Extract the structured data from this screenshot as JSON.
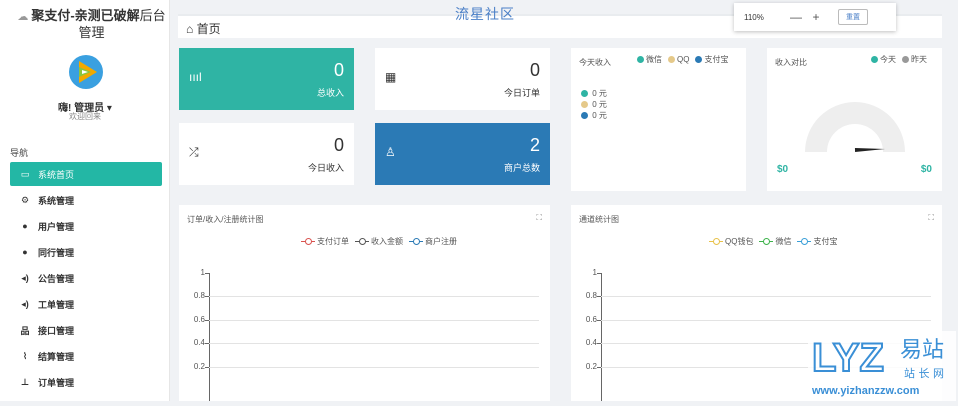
{
  "brand": {
    "cloud_icon": "cloud-icon",
    "bold": "聚支付-亲测已破解",
    "rest": "后台管理"
  },
  "user": {
    "name": "嗨! 管理员 ▾",
    "welcome": "欢迎回来"
  },
  "nav": {
    "header": "导航",
    "items": [
      {
        "label": "系统首页",
        "icon": "▭",
        "active": true
      },
      {
        "label": "系统管理",
        "icon": "⚙",
        "active": false
      },
      {
        "label": "用户管理",
        "icon": "●",
        "active": false
      },
      {
        "label": "同行管理",
        "icon": "●",
        "active": false
      },
      {
        "label": "公告管理",
        "icon": "◂)",
        "active": false
      },
      {
        "label": "工单管理",
        "icon": "◂)",
        "active": false
      },
      {
        "label": "接口管理",
        "icon": "品",
        "active": false
      },
      {
        "label": "结算管理",
        "icon": "⌇",
        "active": false
      },
      {
        "label": "订单管理",
        "icon": "⊥",
        "active": false
      }
    ]
  },
  "topbar": {
    "home_icon": "⌂",
    "title": "首页"
  },
  "watermark_top": "流星社区",
  "zoom": {
    "value": "110%",
    "minus": "—",
    "plus": "+",
    "reset": "重置"
  },
  "tiles": [
    {
      "icon": "ıııl",
      "value": "0",
      "label": "总收入"
    },
    {
      "icon": "▦",
      "value": "0",
      "label": "今日订单"
    },
    {
      "icon": "⤮",
      "value": "0",
      "label": "今日收入"
    },
    {
      "icon": "♙",
      "value": "2",
      "label": "商户总数"
    }
  ],
  "today_income": {
    "title": "今天收入",
    "legend": [
      "微信",
      "QQ",
      "支付宝"
    ],
    "items": [
      "0 元",
      "0 元",
      "0 元"
    ],
    "colors": [
      "#2fb4a4",
      "#e5c98a",
      "#2b7ab5"
    ]
  },
  "compare": {
    "title": "收入对比",
    "legend": [
      "今天",
      "昨天"
    ],
    "left": "$0",
    "right": "$0"
  },
  "chart1": {
    "title": "订单/收入/注册统计图",
    "expand": "⛶",
    "legend": [
      "支付订单",
      "收入金额",
      "商户注册"
    ]
  },
  "chart2": {
    "title": "通道统计图",
    "expand": "⛶",
    "legend": [
      "QQ钱包",
      "微信",
      "支付宝"
    ]
  },
  "chart_data": [
    {
      "type": "line",
      "title": "订单/收入/注册统计图",
      "series": [
        {
          "name": "支付订单",
          "values": []
        },
        {
          "name": "收入金额",
          "values": []
        },
        {
          "name": "商户注册",
          "values": []
        }
      ],
      "yticks": [
        "1",
        "0.8",
        "0.6",
        "0.4",
        "0.2"
      ],
      "ylim": [
        0,
        1
      ],
      "grid": true,
      "legend": "top-center"
    },
    {
      "type": "line",
      "title": "通道统计图",
      "series": [
        {
          "name": "QQ钱包",
          "values": []
        },
        {
          "name": "微信",
          "values": []
        },
        {
          "name": "支付宝",
          "values": []
        }
      ],
      "yticks": [
        "1",
        "0.8",
        "0.6",
        "0.4",
        "0.2"
      ],
      "ylim": [
        0,
        1
      ],
      "grid": true,
      "legend": "top-center"
    }
  ],
  "watermark_logo": {
    "big": "LYZ",
    "cn": "易站",
    "sub": "站 长 网",
    "url": "www.yizhanzzw.com"
  }
}
